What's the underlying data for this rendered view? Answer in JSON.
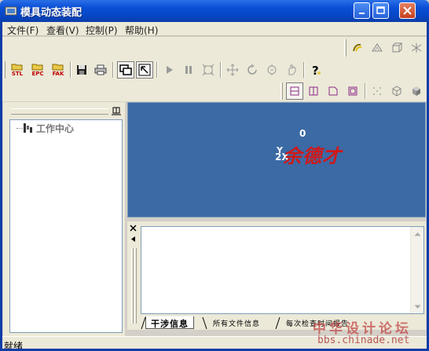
{
  "window": {
    "title": "模具动态装配",
    "minimize_label": "▬",
    "maximize_label": "▢",
    "close_label": "✕"
  },
  "menu": {
    "items": [
      "文件(F)",
      "查看(V)",
      "控制(P)",
      "帮助(H)"
    ]
  },
  "toolbar": {
    "stl_label": "STL",
    "epc_label": "EPC",
    "fak_label": "FAK"
  },
  "tree": {
    "root_label": "工作中心"
  },
  "viewport": {
    "axis_zero": "0",
    "axis_y": "Y",
    "axis_2x": "2X",
    "overlay_text": "余德才"
  },
  "output": {
    "tabs": [
      "干涉信息",
      "所有文件信息",
      "每次检查时间报告"
    ]
  },
  "status": {
    "text": "就绪"
  },
  "watermark": {
    "forum_name": "中华设计论坛",
    "url": "bbs.chinade.net"
  },
  "colors": {
    "titlebar": "#0a4fd6",
    "viewport_bg": "#3b6aa5",
    "overlay_red": "#d01818"
  }
}
